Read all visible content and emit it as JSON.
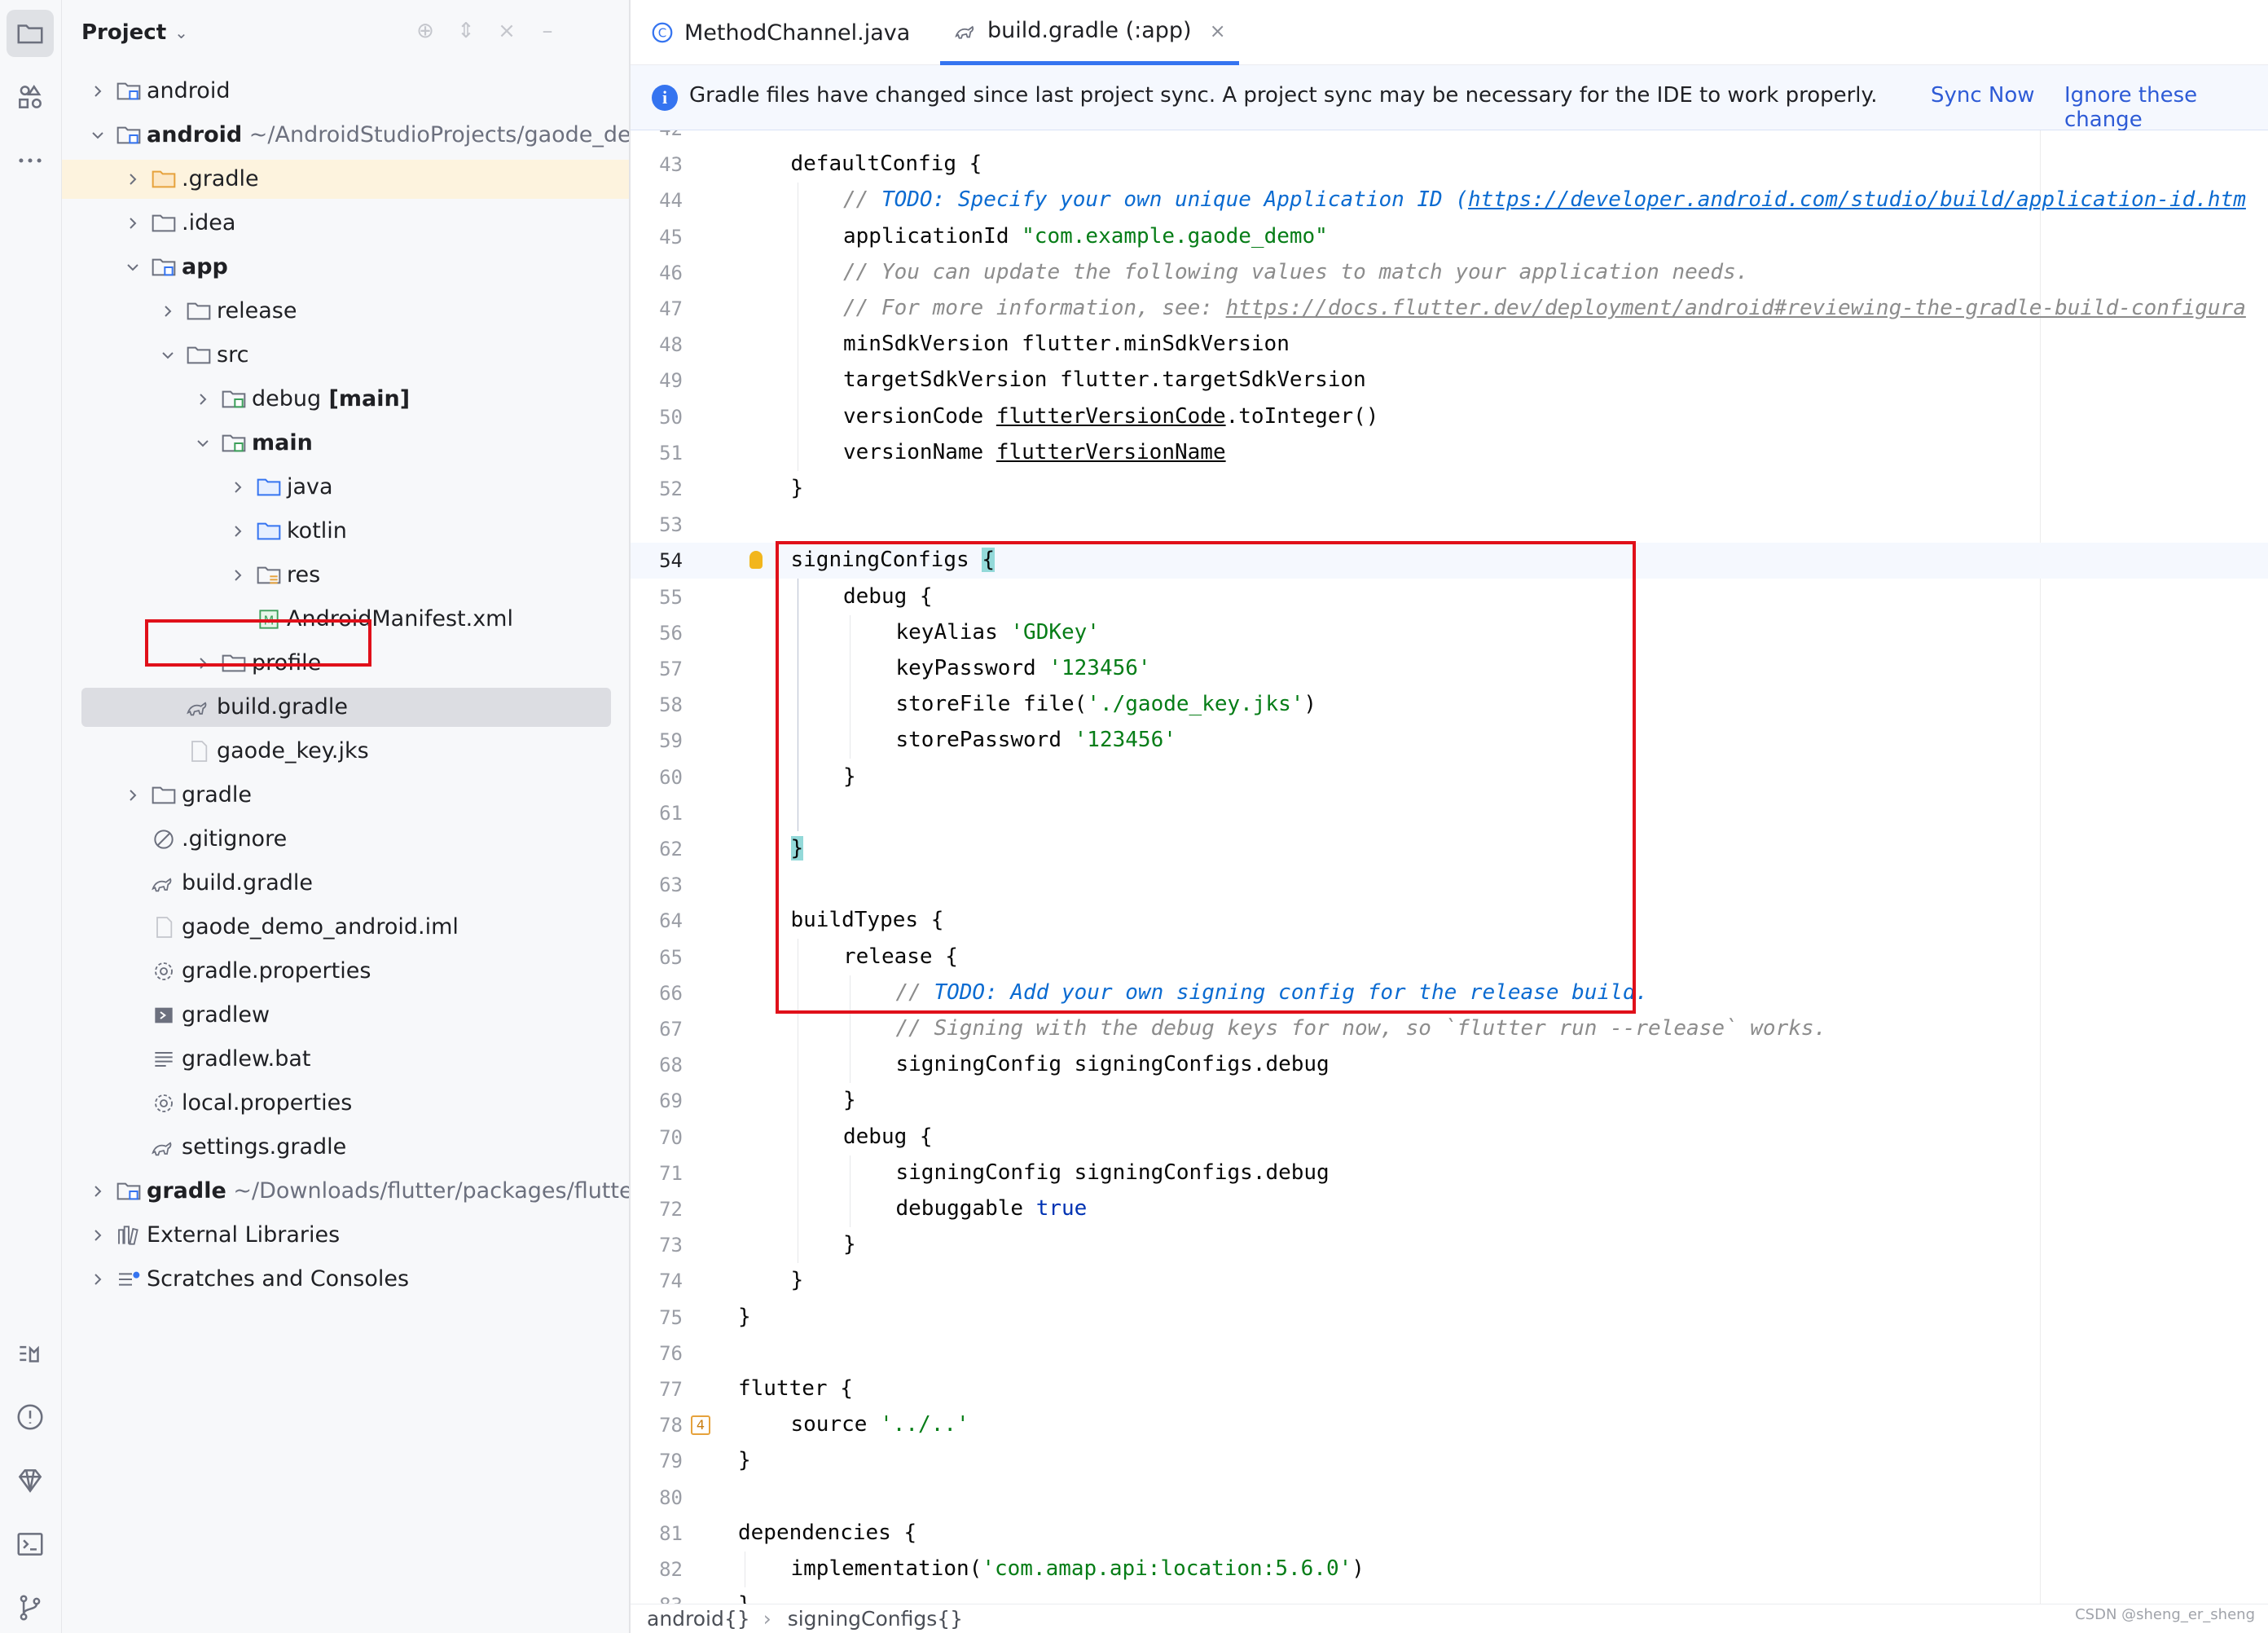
{
  "project_panel": {
    "title": "Project",
    "items": [
      {
        "label": "android",
        "path": "",
        "depth": 0,
        "arrow": "right",
        "icon": "module-folder-icon",
        "bold": false
      },
      {
        "label": "android",
        "path": " ~/AndroidStudioProjects/gaode_demo/a",
        "depth": 0,
        "arrow": "down",
        "icon": "module-folder-icon",
        "bold": true
      },
      {
        "label": ".gradle",
        "path": "",
        "depth": 1,
        "arrow": "right",
        "icon": "folder-orange-icon",
        "bold": false,
        "highlight": true
      },
      {
        "label": ".idea",
        "path": "",
        "depth": 1,
        "arrow": "right",
        "icon": "folder-icon",
        "bold": false
      },
      {
        "label": "app",
        "path": "",
        "depth": 1,
        "arrow": "down",
        "icon": "module-folder-icon",
        "bold": true
      },
      {
        "label": "release",
        "path": "",
        "depth": 2,
        "arrow": "right",
        "icon": "folder-icon",
        "bold": false
      },
      {
        "label": "src",
        "path": "",
        "depth": 2,
        "arrow": "down",
        "icon": "folder-icon",
        "bold": false
      },
      {
        "label": "debug",
        "tag": " [main]",
        "path": "",
        "depth": 3,
        "arrow": "right",
        "icon": "source-set-folder-icon",
        "bold": false
      },
      {
        "label": "main",
        "path": "",
        "depth": 3,
        "arrow": "down",
        "icon": "source-set-folder-icon",
        "bold": true
      },
      {
        "label": "java",
        "path": "",
        "depth": 4,
        "arrow": "right",
        "icon": "folder-blue-icon",
        "bold": false
      },
      {
        "label": "kotlin",
        "path": "",
        "depth": 4,
        "arrow": "right",
        "icon": "folder-blue-icon",
        "bold": false
      },
      {
        "label": "res",
        "path": "",
        "depth": 4,
        "arrow": "right",
        "icon": "resource-folder-icon",
        "bold": false
      },
      {
        "label": "AndroidManifest.xml",
        "path": "",
        "depth": 4,
        "arrow": "none",
        "icon": "manifest-icon",
        "bold": false
      },
      {
        "label": "profile",
        "path": "",
        "depth": 3,
        "arrow": "right",
        "icon": "folder-icon",
        "bold": false
      },
      {
        "label": "build.gradle",
        "path": "",
        "depth": 2,
        "arrow": "none",
        "icon": "gradle-icon",
        "bold": false,
        "selected": true
      },
      {
        "label": "gaode_key.jks",
        "path": "",
        "depth": 2,
        "arrow": "none",
        "icon": "file-icon",
        "bold": false
      },
      {
        "label": "gradle",
        "path": "",
        "depth": 1,
        "arrow": "right",
        "icon": "folder-icon",
        "bold": false
      },
      {
        "label": ".gitignore",
        "path": "",
        "depth": 1,
        "arrow": "none",
        "icon": "ignore-icon",
        "bold": false
      },
      {
        "label": "build.gradle",
        "path": "",
        "depth": 1,
        "arrow": "none",
        "icon": "gradle-icon",
        "bold": false
      },
      {
        "label": "gaode_demo_android.iml",
        "path": "",
        "depth": 1,
        "arrow": "none",
        "icon": "file-icon",
        "bold": false
      },
      {
        "label": "gradle.properties",
        "path": "",
        "depth": 1,
        "arrow": "none",
        "icon": "settings-gear-icon",
        "bold": false
      },
      {
        "label": "gradlew",
        "path": "",
        "depth": 1,
        "arrow": "none",
        "icon": "script-icon",
        "bold": false
      },
      {
        "label": "gradlew.bat",
        "path": "",
        "depth": 1,
        "arrow": "none",
        "icon": "text-lines-icon",
        "bold": false
      },
      {
        "label": "local.properties",
        "path": "",
        "depth": 1,
        "arrow": "none",
        "icon": "settings-gear-icon",
        "bold": false
      },
      {
        "label": "settings.gradle",
        "path": "",
        "depth": 1,
        "arrow": "none",
        "icon": "gradle-icon",
        "bold": false
      },
      {
        "label": "gradle",
        "path": " ~/Downloads/flutter/packages/flutter_too",
        "depth": 0,
        "arrow": "right",
        "icon": "module-folder-icon",
        "bold": true
      },
      {
        "label": "External Libraries",
        "path": "",
        "depth": 0,
        "arrow": "right",
        "icon": "library-icon",
        "bold": false
      },
      {
        "label": "Scratches and Consoles",
        "path": "",
        "depth": 0,
        "arrow": "right",
        "icon": "scratches-icon",
        "bold": false
      }
    ]
  },
  "tabs": [
    {
      "label": "MethodChannel.java",
      "icon": "java-class-icon",
      "active": false
    },
    {
      "label": "build.gradle (:app)",
      "icon": "gradle-icon",
      "active": true
    }
  ],
  "notification": {
    "text": "Gradle files have changed since last project sync. A project sync may be necessary for the IDE to work properly.",
    "sync_label": "Sync Now",
    "ignore_label": "Ignore these change"
  },
  "editor": {
    "current_line": 54,
    "lines": [
      {
        "n": 42,
        "segs": []
      },
      {
        "n": 43,
        "indent": 1,
        "segs": [
          [
            "defaultConfig ",
            ""
          ],
          [
            "{",
            ""
          ]
        ]
      },
      {
        "n": 44,
        "indent": 2,
        "segs": [
          [
            "// ",
            "cmt"
          ],
          [
            "TODO: Specify your own unique Application ID (",
            "todo"
          ],
          [
            "https://developer.android.com/studio/build/application-id.htm",
            "todo lnk"
          ]
        ]
      },
      {
        "n": 45,
        "indent": 2,
        "segs": [
          [
            "applicationId ",
            ""
          ],
          [
            "\"com.example.gaode_demo\"",
            "str"
          ]
        ]
      },
      {
        "n": 46,
        "indent": 2,
        "segs": [
          [
            "// You can update the following values to match your application needs.",
            "cmt"
          ]
        ]
      },
      {
        "n": 47,
        "indent": 2,
        "segs": [
          [
            "// For more information, see: ",
            "cmt"
          ],
          [
            "https://docs.flutter.dev/deployment/android#reviewing-the-gradle-build-configura",
            "cmt lnk"
          ]
        ]
      },
      {
        "n": 48,
        "indent": 2,
        "segs": [
          [
            "minSdkVersion flutter.minSdkVersion",
            ""
          ]
        ]
      },
      {
        "n": 49,
        "indent": 2,
        "segs": [
          [
            "targetSdkVersion flutter.targetSdkVersion",
            ""
          ]
        ]
      },
      {
        "n": 50,
        "indent": 2,
        "segs": [
          [
            "versionCode ",
            ""
          ],
          [
            "flutterVersionCode",
            "und"
          ],
          [
            ".toInteger()",
            ""
          ]
        ]
      },
      {
        "n": 51,
        "indent": 2,
        "segs": [
          [
            "versionName ",
            ""
          ],
          [
            "flutterVersionName",
            "und"
          ]
        ]
      },
      {
        "n": 52,
        "indent": 1,
        "segs": [
          [
            "}",
            ""
          ]
        ]
      },
      {
        "n": 53,
        "indent": 0,
        "segs": []
      },
      {
        "n": 54,
        "indent": 1,
        "segs": [
          [
            "signingConfigs ",
            ""
          ],
          [
            "{",
            "brace-hl"
          ]
        ]
      },
      {
        "n": 55,
        "indent": 2,
        "segs": [
          [
            "debug ",
            ""
          ],
          [
            "{",
            ""
          ]
        ]
      },
      {
        "n": 56,
        "indent": 3,
        "segs": [
          [
            "keyAlias ",
            ""
          ],
          [
            "'GDKey'",
            "str"
          ]
        ]
      },
      {
        "n": 57,
        "indent": 3,
        "segs": [
          [
            "keyPassword ",
            ""
          ],
          [
            "'123456'",
            "str"
          ]
        ]
      },
      {
        "n": 58,
        "indent": 3,
        "segs": [
          [
            "storeFile file(",
            ""
          ],
          [
            "'./gaode_key.jks'",
            "str"
          ],
          [
            ")",
            ""
          ]
        ]
      },
      {
        "n": 59,
        "indent": 3,
        "segs": [
          [
            "storePassword ",
            ""
          ],
          [
            "'123456'",
            "str"
          ]
        ]
      },
      {
        "n": 60,
        "indent": 2,
        "segs": [
          [
            "}",
            ""
          ]
        ]
      },
      {
        "n": 61,
        "indent": 0,
        "segs": []
      },
      {
        "n": 62,
        "indent": 1,
        "segs": [
          [
            "}",
            "brace-hl"
          ]
        ]
      },
      {
        "n": 63,
        "indent": 0,
        "segs": []
      },
      {
        "n": 64,
        "indent": 1,
        "segs": [
          [
            "buildTypes ",
            ""
          ],
          [
            "{",
            ""
          ]
        ]
      },
      {
        "n": 65,
        "indent": 2,
        "segs": [
          [
            "release ",
            ""
          ],
          [
            "{",
            ""
          ]
        ]
      },
      {
        "n": 66,
        "indent": 3,
        "segs": [
          [
            "// ",
            "cmt"
          ],
          [
            "TODO: Add your own signing config for the release build.",
            "todo"
          ]
        ]
      },
      {
        "n": 67,
        "indent": 3,
        "segs": [
          [
            "// Signing with the debug keys for now, so `flutter run --release` works.",
            "cmt"
          ]
        ]
      },
      {
        "n": 68,
        "indent": 3,
        "segs": [
          [
            "signingConfig signingConfigs.debug",
            ""
          ]
        ]
      },
      {
        "n": 69,
        "indent": 2,
        "segs": [
          [
            "}",
            ""
          ]
        ]
      },
      {
        "n": 70,
        "indent": 2,
        "segs": [
          [
            "debug ",
            ""
          ],
          [
            "{",
            ""
          ]
        ]
      },
      {
        "n": 71,
        "indent": 3,
        "segs": [
          [
            "signingConfig signingConfigs.debug",
            ""
          ]
        ]
      },
      {
        "n": 72,
        "indent": 3,
        "segs": [
          [
            "debuggable ",
            ""
          ],
          [
            "true",
            "kw"
          ]
        ]
      },
      {
        "n": 73,
        "indent": 2,
        "segs": [
          [
            "}",
            ""
          ]
        ]
      },
      {
        "n": 74,
        "indent": 1,
        "segs": [
          [
            "}",
            ""
          ]
        ]
      },
      {
        "n": 75,
        "indent": 0,
        "segs": [
          [
            "}",
            ""
          ]
        ]
      },
      {
        "n": 76,
        "indent": 0,
        "segs": []
      },
      {
        "n": 77,
        "indent": 0,
        "segs": [
          [
            "flutter ",
            ""
          ],
          [
            "{",
            ""
          ]
        ]
      },
      {
        "n": 78,
        "indent": 1,
        "segs": [
          [
            "source ",
            ""
          ],
          [
            "'../..'",
            "str"
          ]
        ],
        "badge": "4"
      },
      {
        "n": 79,
        "indent": 0,
        "segs": [
          [
            "}",
            ""
          ]
        ]
      },
      {
        "n": 80,
        "indent": 0,
        "segs": []
      },
      {
        "n": 81,
        "indent": 0,
        "segs": [
          [
            "dependencies ",
            ""
          ],
          [
            "{",
            ""
          ]
        ]
      },
      {
        "n": 82,
        "indent": 1,
        "segs": [
          [
            "implementation(",
            ""
          ],
          [
            "'com.amap.api:location:5.6.0'",
            "str"
          ],
          [
            ")",
            ""
          ]
        ]
      },
      {
        "n": 83,
        "indent": 0,
        "segs": [
          [
            "}",
            ""
          ]
        ]
      }
    ]
  },
  "breadcrumbs": [
    "android{}",
    "signingConfigs{}"
  ],
  "watermark": "CSDN @sheng_er_sheng",
  "colors": {
    "accent": "#3574f0",
    "annotation_red": "#e0101a",
    "string": "#067d17",
    "comment": "#8c8c8c"
  }
}
